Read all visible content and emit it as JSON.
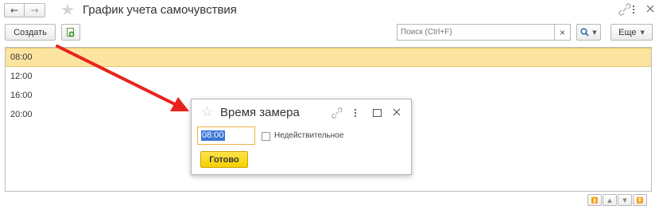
{
  "window": {
    "title": "График учета самочувствия",
    "nav_back": "←",
    "nav_forward": "→"
  },
  "toolbar": {
    "create_label": "Создать",
    "search_placeholder": "Поиск (Ctrl+F)",
    "search_clear": "×",
    "more_label": "Еще"
  },
  "list": {
    "rows": [
      "08:00",
      "12:00",
      "16:00",
      "20:00"
    ],
    "selected_index": 0
  },
  "dialog": {
    "title": "Время замера",
    "time_value": "08:00",
    "checkbox_label": "Недействительное",
    "checkbox_checked": false,
    "ok_label": "Готово"
  },
  "colors": {
    "selected_row": "#fbe4a0",
    "accent_yellow": "#f5d000",
    "arrow": "#e8231b",
    "focus_border": "#f0b23e",
    "search_icon": "#2f6eb8"
  }
}
